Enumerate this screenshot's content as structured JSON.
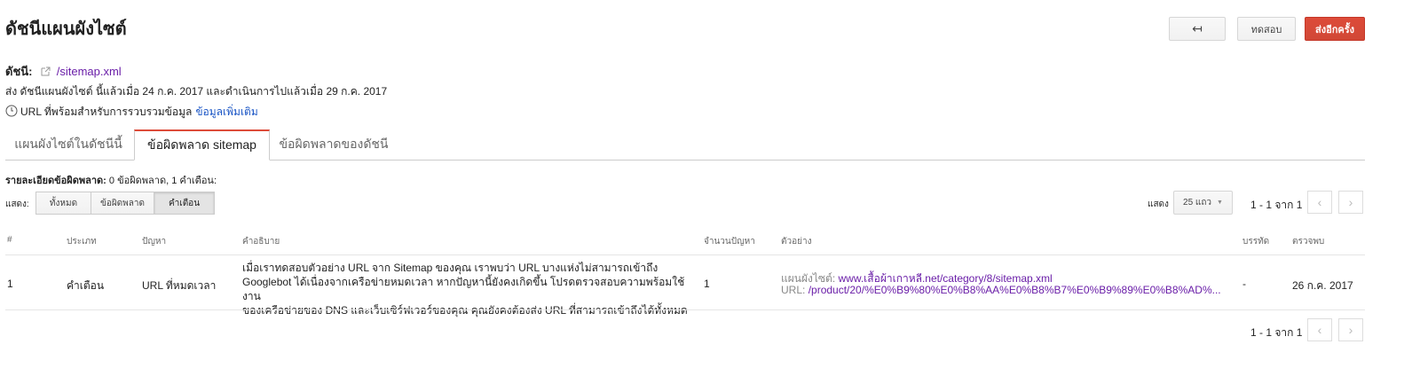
{
  "header": {
    "title": "ดัชนีแผนผังไซต์",
    "back_label": "↤",
    "test_label": "ทดสอบ",
    "resubmit_label": "ส่งอีกครั้ง"
  },
  "info": {
    "index_label": "ดัชนี:",
    "index_link": "/sitemap.xml",
    "submitted_text": "ส่ง ดัชนีแผนผังไซต์ นี้แล้วเมื่อ 24 ก.ค. 2017 และดำเนินการไปแล้วเมื่อ 29 ก.ค. 2017",
    "crawl_text": "URL ที่พร้อมสำหรับการรวบรวมข้อมูล",
    "learn_more": "ข้อมูลเพิ่มเติม"
  },
  "tabs": [
    {
      "label": "แผนผังไซต์ในดัชนีนี้"
    },
    {
      "label": "ข้อผิดพลาด sitemap"
    },
    {
      "label": "ข้อผิดพลาดของดัชนี"
    }
  ],
  "errors": {
    "summary_label": "รายละเอียดข้อผิดพลาด:",
    "summary_value": "0 ข้อผิดพลาด, 1 คำเตือน:",
    "show_label": "แสดง:",
    "filters": [
      "ทั้งหมด",
      "ข้อผิดพลาด",
      "คำเตือน"
    ]
  },
  "paging": {
    "show_label": "แสดง",
    "rows_select": "25 แถว",
    "range": "1 - 1 จาก 1",
    "prev_icon": "‹",
    "next_icon": "›"
  },
  "table": {
    "columns": [
      "#",
      "ประเภท",
      "ปัญหา",
      "คำอธิบาย",
      "จำนวนปัญหา",
      "ตัวอย่าง",
      "บรรทัด",
      "ตรวจพบ"
    ],
    "rows": [
      {
        "num": "1",
        "type": "คำเตือน",
        "issue": "URL ที่หมดเวลา",
        "description_lines": [
          "เมื่อเราทดสอบตัวอย่าง URL จาก Sitemap ของคุณ เราพบว่า URL บางแห่งไม่สามารถเข้าถึง",
          "Googlebot ได้เนื่องจากเครือข่ายหมดเวลา หากปัญหานี้ยังคงเกิดขึ้น โปรดตรวจสอบความพร้อมใช้งาน",
          "ของเครือข่ายของ DNS และเว็บเซิร์ฟเวอร์ของคุณ คุณยังคงต้องส่ง URL ที่สามารถเข้าถึงได้ทั้งหมด"
        ],
        "count": "1",
        "example_sitemap_label": "แผนผังไซต์:",
        "example_sitemap_url": "www.เสื้อผ้าเกาหลี.net/category/8/sitemap.xml",
        "example_url_label": "URL:",
        "example_url": "/product/20/%E0%B9%80%E0%B8%AA%E0%B8%B7%E0%B9%89%E0%B8%AD%...",
        "line": "-",
        "detected": "26 ก.ค. 2017"
      }
    ]
  }
}
